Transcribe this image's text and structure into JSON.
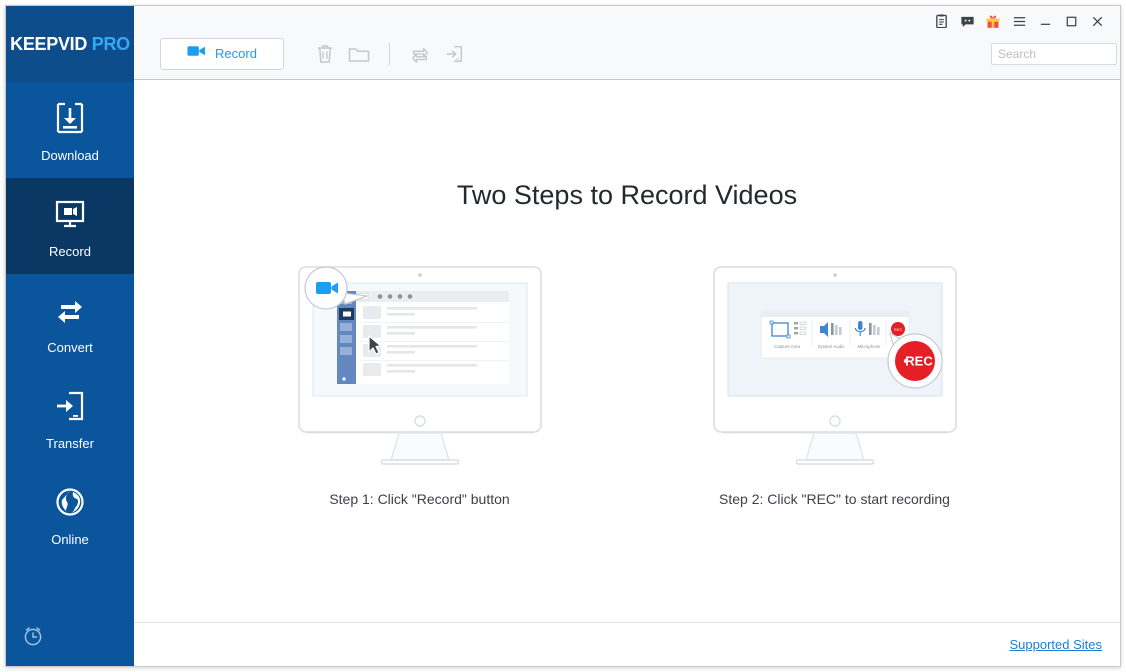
{
  "app": {
    "logo_primary": "KEEPVID",
    "logo_secondary": "PRO",
    "brand_blue": "#0a559c",
    "accent_blue": "#1a9ef0",
    "active_nav_bg": "#0b3765"
  },
  "sidebar": {
    "items": [
      {
        "label": "Download",
        "icon": "download-box-icon",
        "active": false
      },
      {
        "label": "Record",
        "icon": "monitor-camcorder-icon",
        "active": true
      },
      {
        "label": "Convert",
        "icon": "convert-arrows-icon",
        "active": false
      },
      {
        "label": "Transfer",
        "icon": "phone-arrow-icon",
        "active": false
      },
      {
        "label": "Online",
        "icon": "globe-icon",
        "active": false
      }
    ],
    "bottom_icon": "alarm-clock-icon"
  },
  "titlebar": {
    "buttons": [
      {
        "name": "notes-icon",
        "glyph": "὜A"
      },
      {
        "name": "feedback-icon",
        "glyph": ""
      },
      {
        "name": "gift-icon",
        "glyph": ""
      },
      {
        "name": "menu-icon",
        "glyph": "≡"
      },
      {
        "name": "minimize-icon",
        "glyph": "—"
      },
      {
        "name": "maximize-icon",
        "glyph": "□"
      },
      {
        "name": "close-icon",
        "glyph": "✕"
      }
    ]
  },
  "toolbar": {
    "record_label": "Record",
    "icons": [
      {
        "name": "delete-icon",
        "enabled": false
      },
      {
        "name": "folder-icon",
        "enabled": false
      },
      {
        "name": "convert-icon",
        "enabled": false
      },
      {
        "name": "transfer-icon",
        "enabled": false
      }
    ]
  },
  "search": {
    "placeholder": "Search",
    "value": ""
  },
  "main": {
    "title": "Two Steps to Record Videos",
    "steps": [
      {
        "caption": "Step 1: Click \"Record\" button",
        "illustration": "monitor-app-window-with-record-callout"
      },
      {
        "caption": "Step 2: Click \"REC\" to start recording",
        "illustration": "monitor-recorder-toolbar-with-rec-callout"
      }
    ],
    "recorder_toolbar": {
      "capture_area_label": "Capture Area",
      "system_audio_label": "System Audio",
      "microphone_label": "Microphone",
      "rec_label": "Rec",
      "rec_button_text": "REC"
    }
  },
  "footer": {
    "supported_sites_label": "Supported Sites"
  }
}
